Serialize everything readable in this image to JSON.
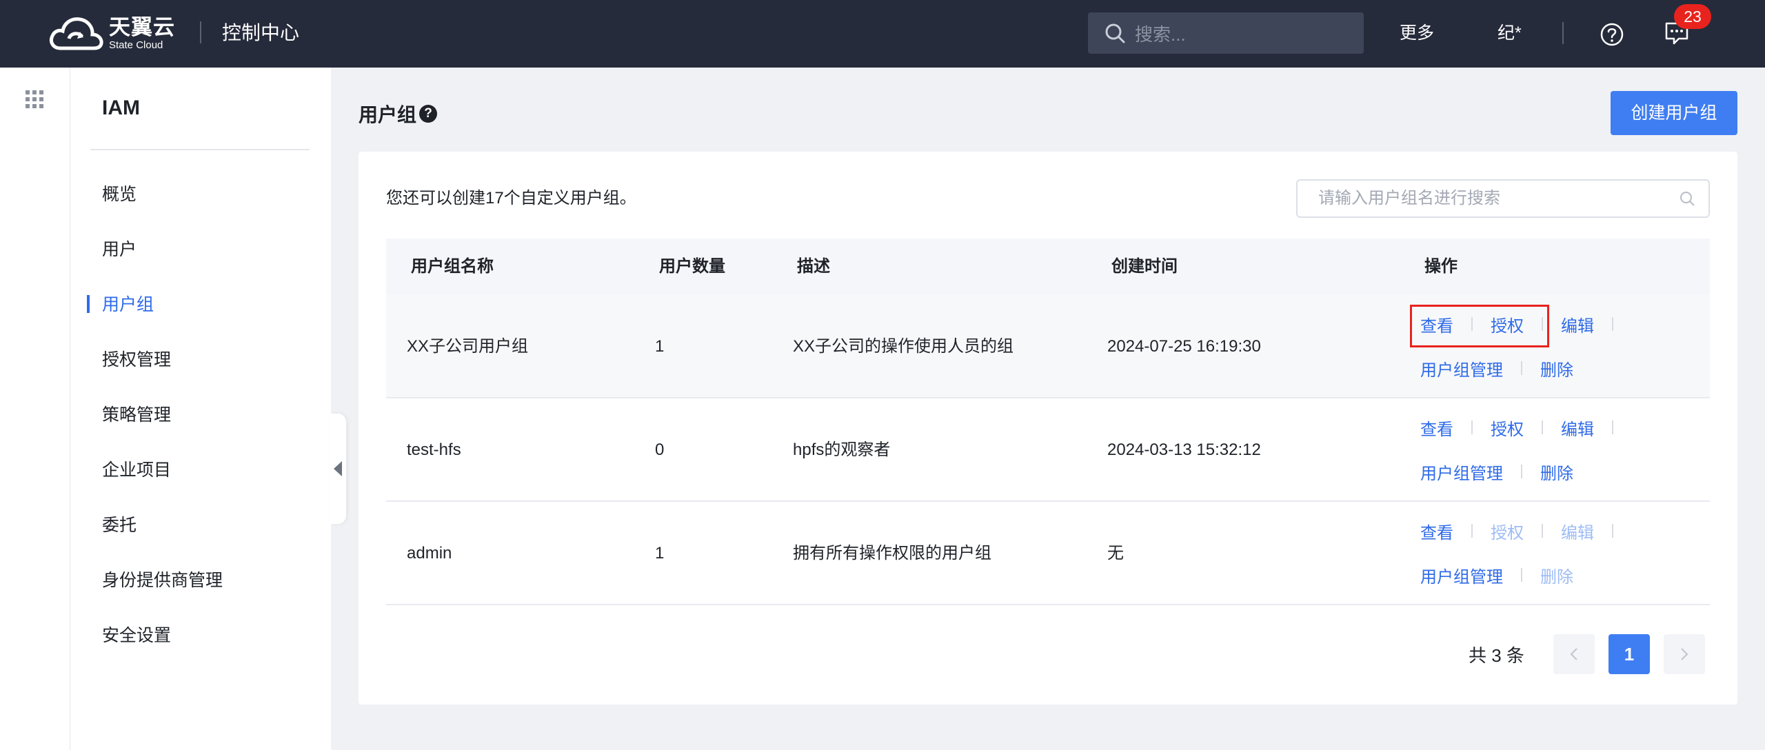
{
  "topbar": {
    "brand_cn": "天翼云",
    "brand_en": "State Cloud",
    "console_title": "控制中心",
    "search_placeholder": "搜索...",
    "more": "更多",
    "user": "纪*",
    "notification_count": "23",
    "icons": [
      "search-icon",
      "help-icon",
      "message-icon"
    ]
  },
  "sidebar": {
    "title": "IAM",
    "items": [
      {
        "label": "概览"
      },
      {
        "label": "用户"
      },
      {
        "label": "用户组",
        "active": true
      },
      {
        "label": "授权管理"
      },
      {
        "label": "策略管理"
      },
      {
        "label": "企业项目"
      },
      {
        "label": "委托"
      },
      {
        "label": "身份提供商管理"
      },
      {
        "label": "安全设置"
      }
    ]
  },
  "main": {
    "title": "用户组",
    "create_button": "创建用户组",
    "hint": "您还可以创建17个自定义用户组。",
    "search_placeholder": "请输入用户组名进行搜索",
    "columns": [
      "用户组名称",
      "用户数量",
      "描述",
      "创建时间",
      "操作"
    ],
    "rows": [
      {
        "name": "XX子公司用户组",
        "count": "1",
        "desc": "XX子公司的操作使用人员的组",
        "created": "2024-07-25 16:19:30"
      },
      {
        "name": "test-hfs",
        "count": "0",
        "desc": "hpfs的观察者",
        "created": "2024-03-13 15:32:12"
      },
      {
        "name": "admin",
        "count": "1",
        "desc": "拥有所有操作权限的用户组",
        "created": "无"
      }
    ],
    "ops": {
      "view": "查看",
      "auth": "授权",
      "edit": "编辑",
      "manage": "用户组管理",
      "delete": "删除"
    },
    "pagination": {
      "total": "共 3 条",
      "current": "1"
    },
    "accent_color": "#3f7ef2",
    "highlight_color": "#e8231d"
  }
}
